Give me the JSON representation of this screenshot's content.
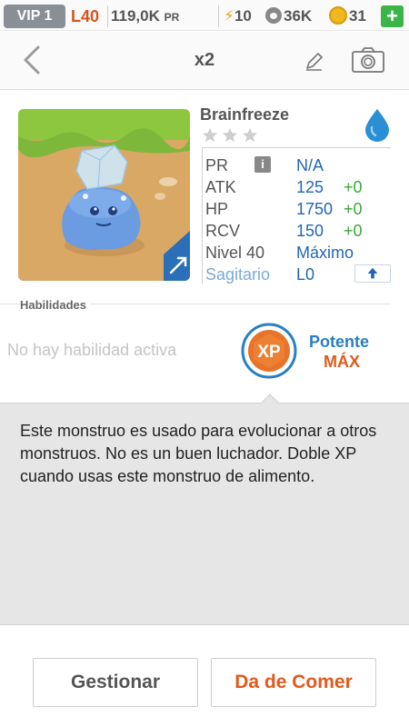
{
  "status": {
    "vip": "VIP 1",
    "level": "L40",
    "pr_amount": "119,0K",
    "pr_unit": "PR",
    "stamina": "10",
    "friend_points": "36K",
    "coins": "31",
    "add_label": "+"
  },
  "nav": {
    "title": "x2"
  },
  "monster": {
    "name": "Brainfreeze",
    "element": "water-drop-icon",
    "rarity_stars": 3,
    "stats": {
      "pr_label": "PR",
      "pr_info": "i",
      "pr_value": "N/A",
      "atk_label": "ATK",
      "atk_value": "125",
      "atk_bonus": "+0",
      "hp_label": "HP",
      "hp_value": "1750",
      "hp_bonus": "+0",
      "rcv_label": "RCV",
      "rcv_value": "150",
      "rcv_bonus": "+0",
      "level_label": "Nivel 40",
      "level_value": "Máximo",
      "sign_label": "Sagitario",
      "sign_value": "L0"
    }
  },
  "abilities": {
    "header": "Habilidades",
    "none_text": "No hay habilidad activa",
    "xp_badge": "XP",
    "xp_title": "Potente",
    "xp_level": "MÁX"
  },
  "description": "Este monstruo es usado para evolucionar a otros monstruos. No es un buen luchador. Doble XP cuando usas este monstruo de alimento.",
  "buttons": {
    "manage": "Gestionar",
    "feed": "Da de Comer"
  },
  "colors": {
    "accent_orange": "#e25a1c",
    "accent_blue": "#2466b3",
    "bonus_green": "#3aa83a",
    "water_blue": "#2b8fd6"
  }
}
